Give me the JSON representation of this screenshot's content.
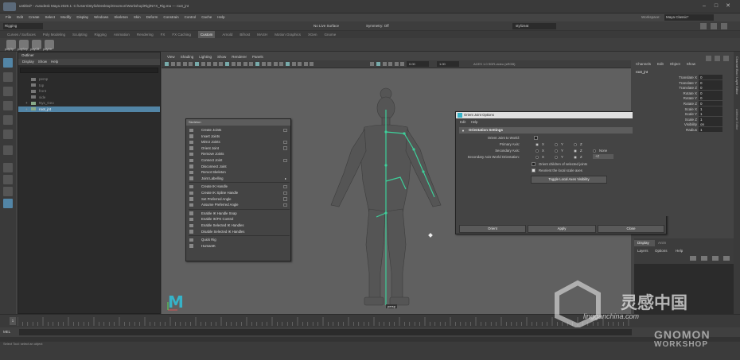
{
  "window": {
    "title": "untitled* - Autodesk Maya 2020.1: C:\\Users\\Stylix\\Desktop\\Gnomon\\Workshop\\Rig\\NYX_Rig.ma --- root_jnt",
    "workspace_label": "Workspace:",
    "workspace_value": "Maya Classic*",
    "minimize": "–",
    "maximize": "□",
    "close": "✕"
  },
  "menubar": [
    "File",
    "Edit",
    "Create",
    "Select",
    "Modify",
    "Display",
    "Windows",
    "Skeleton",
    "Skin",
    "Deform",
    "Constrain",
    "Control",
    "Cache",
    "Help"
  ],
  "statusline": {
    "mode": "Rigging",
    "live_surface": "No Live Surface",
    "symmetry": "Symmetry: Off",
    "login": "stylizeat"
  },
  "shelf_tabs": [
    "Curves / Surfaces",
    "Poly Modeling",
    "Sculpting",
    "Rigging",
    "Animation",
    "Rendering",
    "FX",
    "FX Caching",
    "Custom",
    "Arnold",
    "Bifrost",
    "MASH",
    "Motion Graphics",
    "XGen",
    "Gnome"
  ],
  "shelf_active": "Custom",
  "shelf_icons": [
    "polyOp",
    "polySep",
    "polyCB",
    "polyXtr"
  ],
  "outliner": {
    "title": "Outliner",
    "menu": [
      "Display",
      "Show",
      "Help"
    ],
    "rows": [
      "persp",
      "top",
      "front",
      "side",
      "Nyx_Geo",
      "root_jnt"
    ],
    "selected": "root_jnt"
  },
  "viewport": {
    "menu": [
      "View",
      "Shading",
      "Lighting",
      "Show",
      "Renderer",
      "Panels"
    ],
    "field_a": "0.00",
    "field_b": "1.00",
    "color_space": "ACES 1.0 SDR-video (sRGB)",
    "joint_label": "persp"
  },
  "skeleton_menu": {
    "title": "Skeleton",
    "items": [
      {
        "label": "Create Joints",
        "box": true
      },
      {
        "label": "Insert Joints",
        "box": false
      },
      {
        "label": "Mirror Joints",
        "box": true
      },
      {
        "label": "Orient Joint",
        "box": true
      },
      {
        "label": "Remove Joints",
        "box": false
      },
      {
        "label": "Connect Joint",
        "box": true
      },
      {
        "label": "Disconnect Joint",
        "box": false
      },
      {
        "label": "Reroot Skeleton",
        "box": false
      },
      {
        "label": "Joint Labelling",
        "arrow": true
      },
      {
        "label": "Create IK Handle",
        "box": true
      },
      {
        "label": "Create IK Spline Handle",
        "box": true
      },
      {
        "label": "Set Preferred Angle",
        "box": true
      },
      {
        "label": "Assume Preferred Angle",
        "box": true
      },
      {
        "label": "Enable IK Handle Snap",
        "box": false
      },
      {
        "label": "Enable IK/FK Control",
        "box": false
      },
      {
        "label": "Enable Selected IK Handles",
        "box": false
      },
      {
        "label": "Disable Selected IK Handles",
        "box": false
      },
      {
        "label": "Quick Rig",
        "box": false
      },
      {
        "label": "HumanIK",
        "box": false
      }
    ]
  },
  "orient_dialog": {
    "title": "Orient Joint Options",
    "menu": [
      "Edit",
      "Help"
    ],
    "section": "Orientation Settings",
    "orient_world_label": "Orient Joint to World:",
    "primary_label": "Primary Axis:",
    "secondary_label": "Secondary Axis:",
    "secondary_world_label": "Secondary Axis World Orientation:",
    "axes": [
      "X",
      "Y",
      "Z"
    ],
    "none_label": "None",
    "world_value": "+Z",
    "orient_children": "Orient children of selected joints",
    "reorient_local": "Reorient the local scale axes",
    "toggle_button": "Toggle Local Axes Visibility",
    "buttons": [
      "Orient",
      "Apply",
      "Close"
    ]
  },
  "channel_box": {
    "tabs": [
      "Channels",
      "Edit",
      "Object",
      "Show"
    ],
    "node": "root_jnt",
    "attributes": [
      {
        "name": "Translate X",
        "value": "0"
      },
      {
        "name": "Translate Y",
        "value": "0"
      },
      {
        "name": "Translate Z",
        "value": "0"
      },
      {
        "name": "Rotate X",
        "value": "0"
      },
      {
        "name": "Rotate Y",
        "value": "0"
      },
      {
        "name": "Rotate Z",
        "value": "0"
      },
      {
        "name": "Scale X",
        "value": "1"
      },
      {
        "name": "Scale Y",
        "value": "1"
      },
      {
        "name": "Scale Z",
        "value": "1"
      },
      {
        "name": "Visibility",
        "value": "on"
      },
      {
        "name": "Radius",
        "value": "1"
      }
    ]
  },
  "layer_editor": {
    "tabs": [
      "Display",
      "Anim"
    ],
    "menu": [
      "Layers",
      "Options",
      "Help"
    ]
  },
  "side_tabs": [
    "Channel Box / Layer Editor",
    "Attribute Editor"
  ],
  "timeline": {
    "start_frame": "1",
    "cmd_mode": "MEL",
    "help_text": "Select Tool: select an object"
  },
  "watermark": {
    "cn": "灵感中国",
    "url": "lingganchina.com",
    "brand1": "GNOMON",
    "brand2": "WORKSHOP"
  },
  "colors": {
    "selection": "#5285a6",
    "viewport_bg": "#606060",
    "joint": "#3ecf9a"
  }
}
